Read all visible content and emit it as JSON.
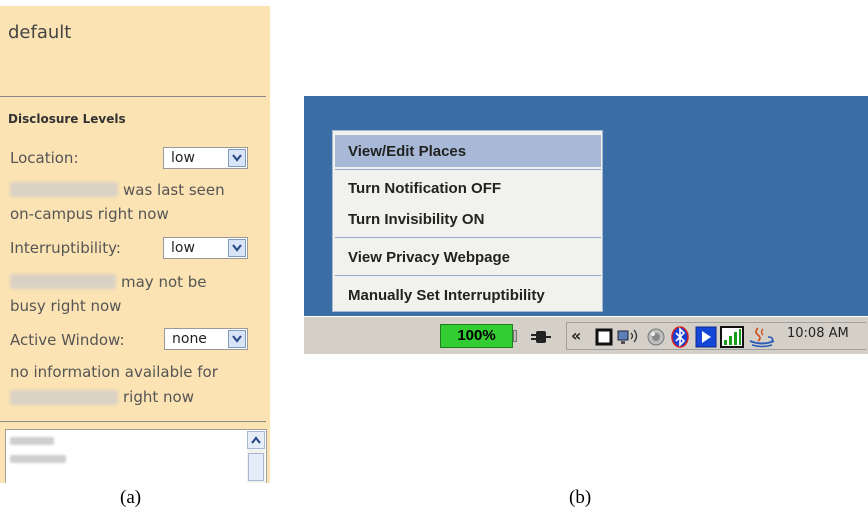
{
  "panel_a": {
    "profile_title": "default",
    "section_title": "Disclosure Levels",
    "location": {
      "label": "Location:",
      "value": "low",
      "status_line1": "was last seen",
      "status_line2": "on-campus right now"
    },
    "interruptibility": {
      "label": "Interruptibility:",
      "value": "low",
      "status_line1": "may not be",
      "status_line2": "busy right now"
    },
    "active_window": {
      "label": "Active Window:",
      "value": "none",
      "status_line1": "no information available for",
      "status_line2": "right now"
    },
    "caption": "(a)"
  },
  "panel_b": {
    "menu_items": [
      "View/Edit Places",
      "Turn Notification OFF",
      "Turn Invisibility ON",
      "View Privacy Webpage",
      "Manually Set Interruptibility"
    ],
    "highlighted_item": "View/Edit Places",
    "battery_label": "100%",
    "battery_level_percent": 100,
    "tray_expand": "«",
    "clock": "10:08 AM",
    "tray_icons": [
      "power-plug-icon",
      "window-icon",
      "network-icon",
      "sound-icon",
      "bluetooth-icon",
      "media-play-icon",
      "signal-icon",
      "java-icon"
    ],
    "caption": "(b)"
  },
  "colors": {
    "panel_bg": "#fbe3b3",
    "desktop": "#3a6ea5",
    "menu_highlight": "#a7b9d6",
    "battery": "#33cc33"
  }
}
